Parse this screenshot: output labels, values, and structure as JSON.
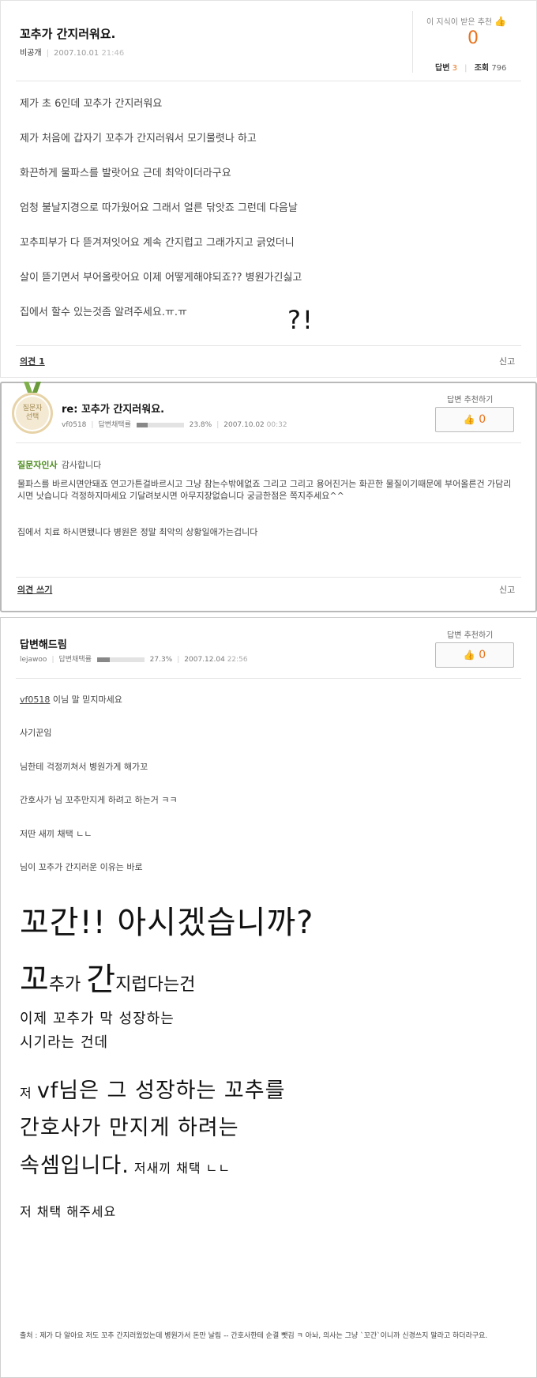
{
  "question": {
    "title": "꼬추가 간지러워요.",
    "author": "비공개",
    "date": "2007.10.01",
    "time": "21:46",
    "vote_label": "이 지식이 받은 추천",
    "vote_count": "0",
    "answers_label": "답변",
    "answers_count": "3",
    "views_label": "조회",
    "views_count": "796",
    "body": [
      "제가 초 6인데 꼬추가 간지러워요",
      "제가 처음에 갑자기 꼬추가 간지러워서 모기물렷나 하고",
      "화끈하게 물파스를 발랏어요 근데 최악이더라구요",
      "엄청 불날지경으로 따가웠어요 그래서 얼른 닦앗죠 그런데 다음날",
      "꼬추피부가 다 뜯겨져잇어요 계속 간지럽고 그래가지고 긁었더니",
      "살이 뜯기면서 부어올랏어요 이제 어떻게해야되죠?? 병원가긴싫고",
      "집에서 할수 있는것좀 알려주세요.ㅠ.ㅠ"
    ],
    "scribble": "?!",
    "opinion_link": "의견 1",
    "report": "신고"
  },
  "answer1": {
    "badge": [
      "질문자",
      "선택"
    ],
    "title": "re: 꼬추가 간지러워요.",
    "author": "vf0518",
    "adopt_label": "답변채택률",
    "adopt_rate": "23.8%",
    "adopt_fraction": 0.238,
    "date": "2007.10.02",
    "time": "00:32",
    "rec_label": "답변 추천하기",
    "rec_count": "0",
    "asker_tag": "질문자인사",
    "asker_msg": "감사합니다",
    "body": "물파스를 바르시면안돼죠 연고가튼걸바르시고 그냥 참는수밖에없죠 그리고 그리고 용어진거는 화끈한 물질이기때문에 부어올른건 가담리시면 낫습니다 걱정하지마세요 기달려보시면 아무지장없습니다 궁금한점은 쪽지주세요^^",
    "body2": "집에서 치료 하시면됐니다 병원은 정말 최악의 상황일애가는겁니다",
    "opinion_link": "의견 쓰기",
    "report": "신고"
  },
  "answer2": {
    "title": "답변해드림",
    "author": "lejawoo",
    "adopt_label": "답변채택률",
    "adopt_rate": "27.3%",
    "adopt_fraction": 0.273,
    "date": "2007.12.04",
    "time": "22:56",
    "rec_label": "답변 추천하기",
    "rec_count": "0",
    "line1_user": "vf0518",
    "line1_rest": " 이님 말 믿지마세요",
    "lines": [
      "사기꾼임",
      "님한테 걱정끼쳐서 병원가게 해가꼬",
      "간호사가 님 꼬추만지게 하려고 하는거 ㅋㅋ",
      "저딴 새끼 채택 ㄴㄴ",
      "님이 꼬추가 간지러운 이유는 바로"
    ],
    "big_line1": "꼬간!! 아시겠습니까?",
    "big2_a": "꼬",
    "big2_b": "추가 ",
    "big2_c": "간",
    "big2_d": "지럽다는건",
    "mid1": "이제 꼬추가 막 성장하는",
    "mid2": "시기라는 건데",
    "big3_a_small": "저 ",
    "big3_a": "vf님은 그 성장하는 꼬추를",
    "big3_b": "간호사가 만지게 하려는",
    "big3_c": "속셈입니다.",
    "big3_c_small": " 저새끼 채택 ㄴㄴ",
    "closing": "저 채택 해주세요",
    "source": "출처 : 제가 다 알아요 저도 꼬추 간지러웠었는데 병원가서 돈만 날림 -- 간호사한테 순결 뺏김 ㅋ 아놔, 의사는 그냥 `꼬간`이니까 신경쓰지 말라고 하더라구요."
  },
  "colors": {
    "accent_orange": "#e8731c",
    "asker_green": "#4a8a1a",
    "thumb": "#e8a530"
  }
}
